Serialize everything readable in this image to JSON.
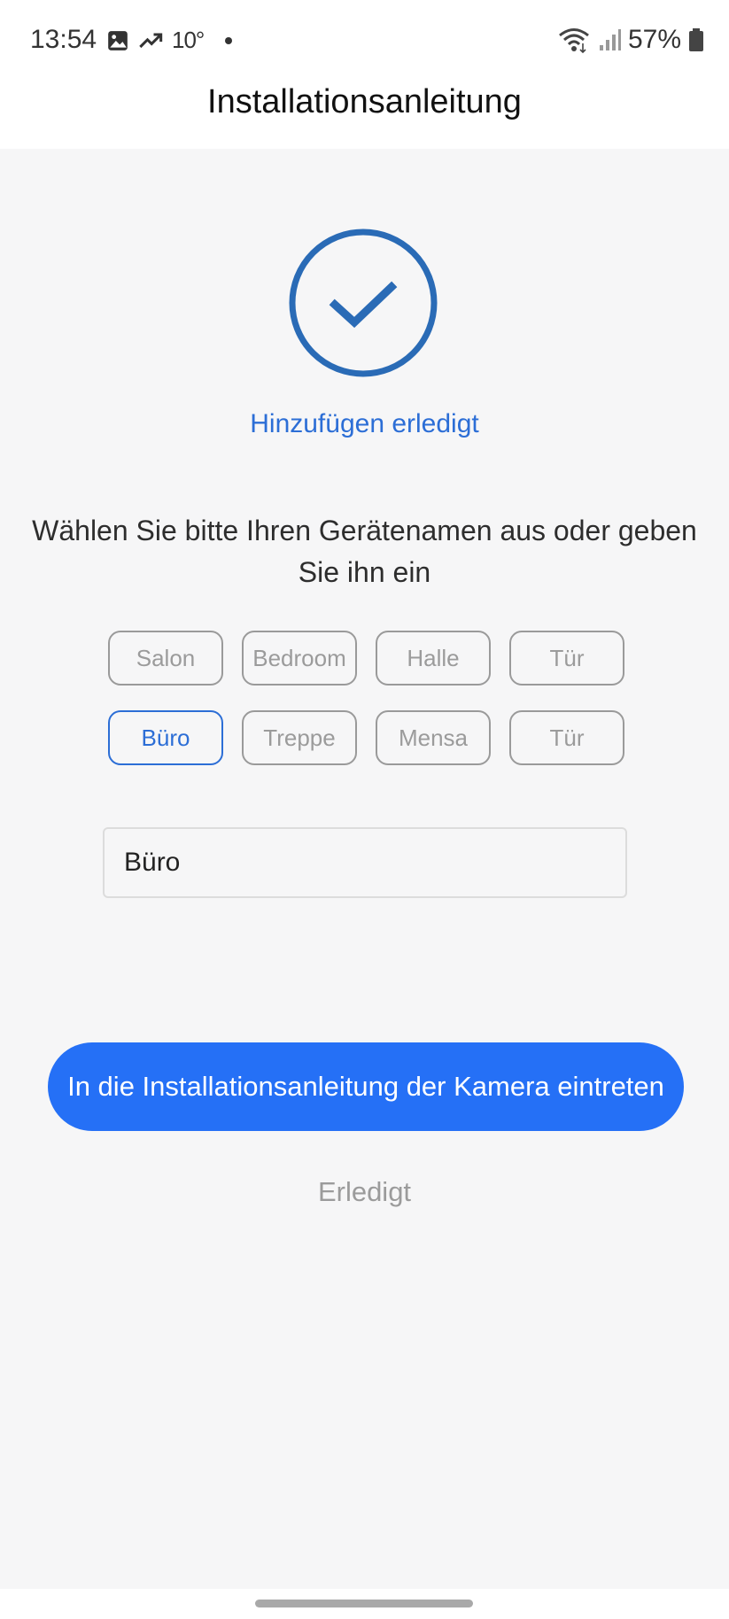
{
  "status_bar": {
    "time": "13:54",
    "temperature": "10°",
    "battery": "57%",
    "icons_left": [
      "gallery-icon",
      "trending-icon",
      "notification-dot"
    ],
    "icons_right": [
      "wifi-icon",
      "signal-icon",
      "battery-icon"
    ]
  },
  "header": {
    "title": "Installationsanleitung"
  },
  "success": {
    "icon": "check-circle-icon",
    "text": "Hinzufügen erledigt",
    "color": "#2c6ed6"
  },
  "prompt": "Wählen Sie bitte Ihren Gerätenamen aus oder geben Sie ihn ein",
  "name_chips": [
    {
      "label": "Salon",
      "selected": false
    },
    {
      "label": "Bedroom",
      "selected": false
    },
    {
      "label": "Halle",
      "selected": false
    },
    {
      "label": "Tür",
      "selected": false
    },
    {
      "label": "Büro",
      "selected": true
    },
    {
      "label": "Treppe",
      "selected": false
    },
    {
      "label": "Mensa",
      "selected": false
    },
    {
      "label": "Tür",
      "selected": false
    }
  ],
  "name_input": {
    "value": "Büro"
  },
  "primary_button": {
    "label": "In die Installationsanleitung der Kamera eintreten",
    "color": "#2570f6"
  },
  "done_link": "Erledigt"
}
